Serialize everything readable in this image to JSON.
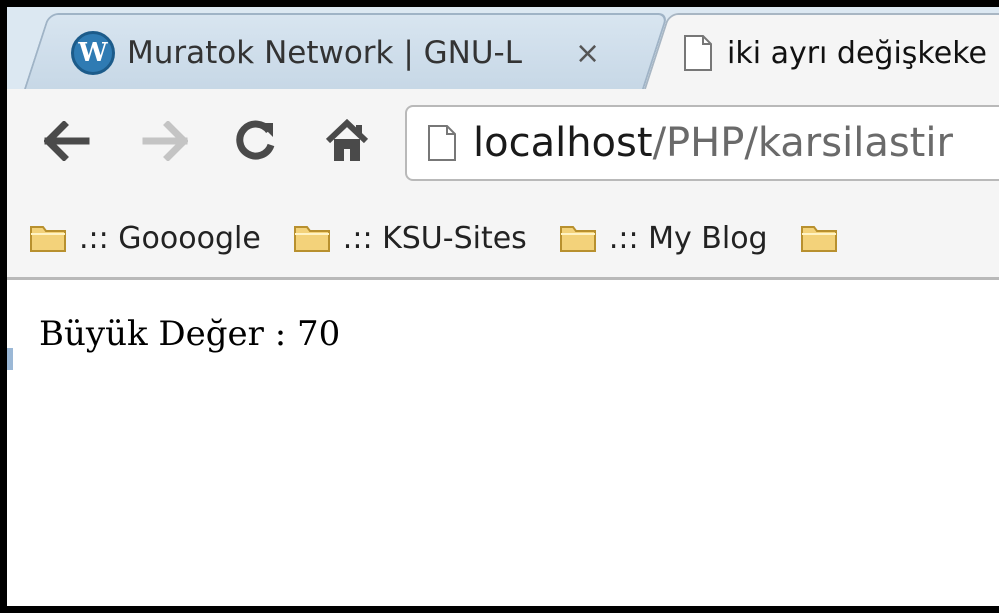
{
  "tabs": [
    {
      "title": "Muratok Network | GNU-L",
      "icon": "wordpress-icon",
      "close": "×",
      "active": false
    },
    {
      "title": "iki ayrı değişkeke",
      "icon": "page-icon",
      "active": true
    }
  ],
  "toolbar": {
    "back_icon": "back-arrow-icon",
    "forward_icon": "forward-arrow-icon",
    "reload_icon": "reload-icon",
    "home_icon": "home-icon"
  },
  "address": {
    "host": "localhost",
    "path": "/PHP/karsilastir"
  },
  "bookmarks": [
    {
      "label": ".:: Goooogle",
      "icon": "folder-icon"
    },
    {
      "label": ".:: KSU-Sites",
      "icon": "folder-icon"
    },
    {
      "label": ".:: My Blog",
      "icon": "folder-icon"
    }
  ],
  "content": {
    "text": "Büyük Değer : 70"
  },
  "colors": {
    "tab_strip": "#dce8f2",
    "toolbar": "#f5f5f5",
    "wordpress_blue": "#2f7bb3",
    "folder_yellow": "#f3d27a"
  }
}
